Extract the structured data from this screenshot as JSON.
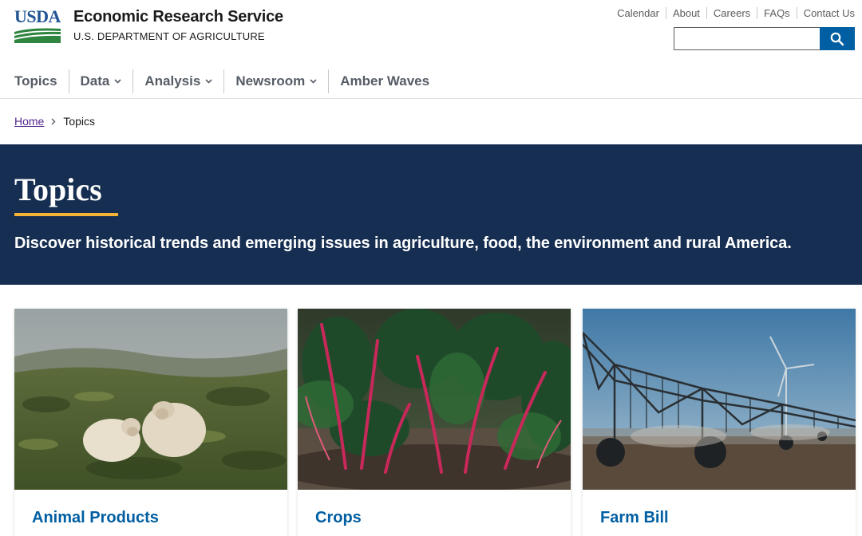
{
  "header": {
    "logo_text": "USDA",
    "site_name": "Economic Research Service",
    "site_sub": "U.S. DEPARTMENT OF AGRICULTURE",
    "search_placeholder": "",
    "search_icon": "search-icon"
  },
  "utility_links": [
    "Calendar",
    "About",
    "Careers",
    "FAQs",
    "Contact Us"
  ],
  "nav": {
    "items": [
      {
        "label": "Topics",
        "has_dropdown": false
      },
      {
        "label": "Data",
        "has_dropdown": true
      },
      {
        "label": "Analysis",
        "has_dropdown": true
      },
      {
        "label": "Newsroom",
        "has_dropdown": true
      },
      {
        "label": "Amber Waves",
        "has_dropdown": false
      }
    ]
  },
  "breadcrumb": {
    "home": "Home",
    "current": "Topics"
  },
  "hero": {
    "title": "Topics",
    "description": "Discover historical trends and emerging issues in agriculture, food, the environment and rural America."
  },
  "cards": [
    {
      "title": "Animal Products",
      "image": "sheep-in-field-image"
    },
    {
      "title": "Crops",
      "image": "chard-plants-image"
    },
    {
      "title": "Farm Bill",
      "image": "irrigation-pivot-image"
    }
  ],
  "colors": {
    "brand_blue": "#005ea2",
    "hero_navy": "#162e51",
    "accent_gold": "#f5b335",
    "usda_green": "#2e8540"
  }
}
